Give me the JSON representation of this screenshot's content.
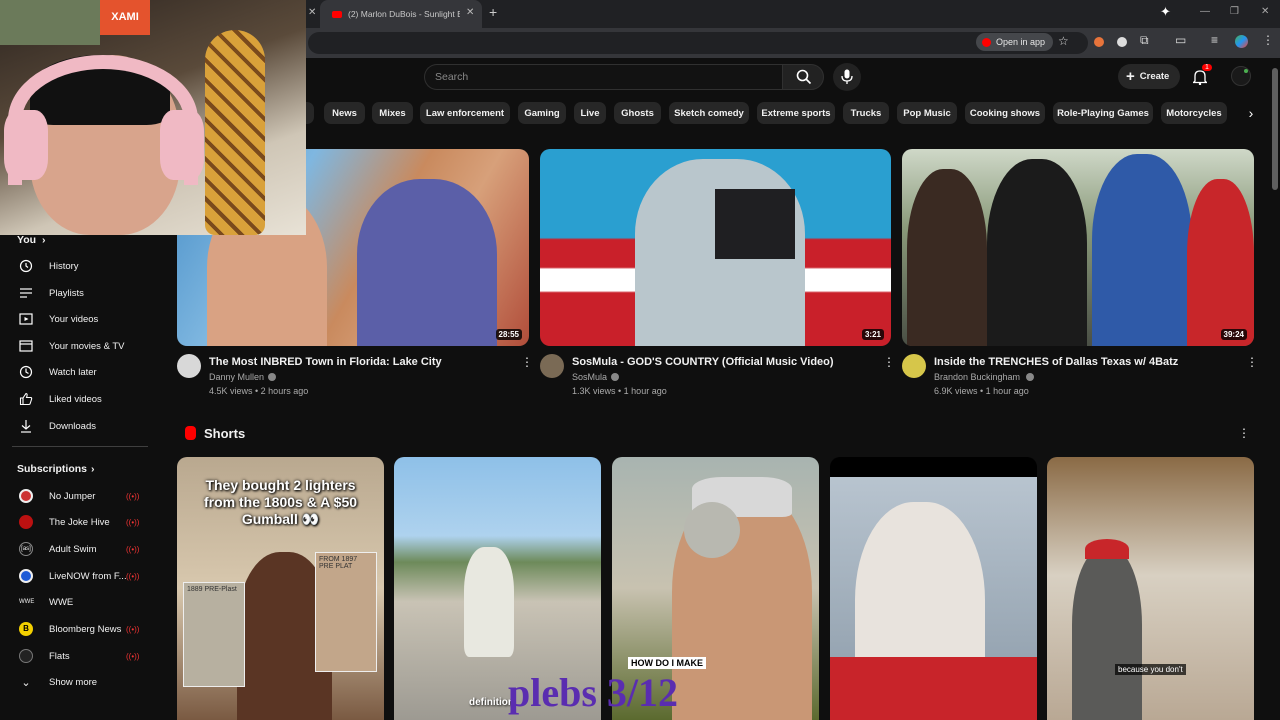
{
  "browser": {
    "tab_title": "(2) Marlon DuBois - Sunlight Bl",
    "open_in_app": "Open in app"
  },
  "header": {
    "search_placeholder": "Search",
    "create_label": "Create",
    "notification_count": "1"
  },
  "chips": [
    "News",
    "Mixes",
    "Law enforcement",
    "Gaming",
    "Live",
    "Ghosts",
    "Sketch comedy",
    "Extreme sports",
    "Trucks",
    "Pop Music",
    "Cooking shows",
    "Role-Playing Games",
    "Motorcycles"
  ],
  "sidebar": {
    "you_label": "You",
    "items": [
      {
        "label": "History",
        "icon": "history-icon"
      },
      {
        "label": "Playlists",
        "icon": "playlists-icon"
      },
      {
        "label": "Your videos",
        "icon": "your-videos-icon"
      },
      {
        "label": "Your movies & TV",
        "icon": "movies-icon"
      },
      {
        "label": "Watch later",
        "icon": "clock-icon"
      },
      {
        "label": "Liked videos",
        "icon": "thumbs-up-icon"
      },
      {
        "label": "Downloads",
        "icon": "download-icon"
      }
    ],
    "subscriptions_label": "Subscriptions",
    "subscriptions": [
      "No Jumper",
      "The Joke Hive",
      "Adult Swim",
      "LiveNOW from F...",
      "WWE",
      "Bloomberg News",
      "Flats"
    ],
    "show_more": "Show more"
  },
  "videos": [
    {
      "title": "The Most INBRED Town in Florida: Lake City",
      "channel": "Danny Mullen",
      "meta": "4.5K views • 2 hours ago",
      "duration": "28:55"
    },
    {
      "title": "SosMula - GOD'S COUNTRY (Official Music Video)",
      "channel": "SosMula",
      "meta": "1.3K views • 1 hour ago",
      "duration": "3:21"
    },
    {
      "title": "Inside the TRENCHES of Dallas Texas w/ 4Batz",
      "channel": "Brandon Buckingham",
      "meta": "6.9K views • 1 hour ago",
      "duration": "39:24"
    }
  ],
  "shorts": {
    "heading": "Shorts",
    "first_caption": "They bought 2 lighters from the 1800s & A $50 Gumball 👀",
    "first_bag_left": "1889 PRE-Plast",
    "first_bag_right": "FROM 1897 PRE PLAT",
    "second_caption": "definition",
    "third_caption": "HOW DO I MAKE",
    "fifth_caption": "because you don't"
  },
  "webcam_overlay": {
    "poster_text": "XAMI"
  },
  "stream_overlay": "plebs 3/12",
  "colors": {
    "accent": "#ff0000",
    "chip_bg": "#272727",
    "page_bg": "#0f0f0f"
  }
}
